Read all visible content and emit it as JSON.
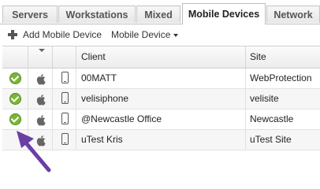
{
  "tabs": [
    {
      "label": "Servers",
      "active": false
    },
    {
      "label": "Workstations",
      "active": false
    },
    {
      "label": "Mixed",
      "active": false
    },
    {
      "label": "Mobile Devices",
      "active": true
    },
    {
      "label": "Network",
      "active": false
    }
  ],
  "toolbar": {
    "add_label": "Add Mobile Device",
    "add_icon": "plus-icon",
    "menu_label": "Mobile Device",
    "menu_icon": "caret-down-icon"
  },
  "grid": {
    "columns": [
      "",
      "",
      "",
      "Client",
      "Site"
    ],
    "rows": [
      {
        "status": "ok",
        "os": "apple",
        "device": "phone",
        "client": "00MATT",
        "site": "WebProtection"
      },
      {
        "status": "ok",
        "os": "apple",
        "device": "phone",
        "client": "velisiphone",
        "site": "velisite"
      },
      {
        "status": "ok",
        "os": "apple",
        "device": "phone",
        "client": "@Newcastle Office",
        "site": "Newcastle"
      },
      {
        "status": "none",
        "os": "apple",
        "device": "phone",
        "client": "uTest Kris",
        "site": "uTest Site"
      }
    ]
  },
  "colors": {
    "status_ok": "#7ab53a",
    "annotation_arrow": "#6a3fa5"
  }
}
